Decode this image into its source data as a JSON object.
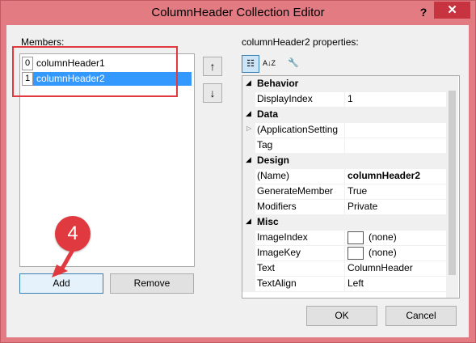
{
  "window": {
    "title": "ColumnHeader Collection Editor",
    "help_label": "?",
    "close_label": "✕"
  },
  "members": {
    "label": "Members:",
    "items": [
      {
        "index": "0",
        "name": "columnHeader1",
        "selected": false
      },
      {
        "index": "1",
        "name": "columnHeader2",
        "selected": true
      }
    ],
    "move_up": "↑",
    "move_down": "↓",
    "add_label": "Add",
    "remove_label": "Remove"
  },
  "annotation": {
    "step_number": "4",
    "color": "#e0393f"
  },
  "properties": {
    "label": "columnHeader2 properties:",
    "toolbar": {
      "categorized": "☷",
      "alphabetical": "A↓Z",
      "property_pages": "🔧"
    },
    "rows": [
      {
        "kind": "category",
        "name": "Behavior"
      },
      {
        "kind": "prop",
        "name": "DisplayIndex",
        "value": "1"
      },
      {
        "kind": "category",
        "name": "Data"
      },
      {
        "kind": "prop",
        "name": "(ApplicationSetting",
        "value": "",
        "expandable": true
      },
      {
        "kind": "prop",
        "name": "Tag",
        "value": ""
      },
      {
        "kind": "category",
        "name": "Design"
      },
      {
        "kind": "prop",
        "name": "(Name)",
        "value": "columnHeader2",
        "bold": true
      },
      {
        "kind": "prop",
        "name": "GenerateMember",
        "value": "True"
      },
      {
        "kind": "prop",
        "name": "Modifiers",
        "value": "Private"
      },
      {
        "kind": "category",
        "name": "Misc"
      },
      {
        "kind": "prop",
        "name": "ImageIndex",
        "value": "(none)",
        "swatch": true
      },
      {
        "kind": "prop",
        "name": "ImageKey",
        "value": "(none)",
        "swatch": true
      },
      {
        "kind": "prop",
        "name": "Text",
        "value": "ColumnHeader"
      },
      {
        "kind": "prop",
        "name": "TextAlign",
        "value": "Left"
      }
    ]
  },
  "footer": {
    "ok_label": "OK",
    "cancel_label": "Cancel"
  }
}
